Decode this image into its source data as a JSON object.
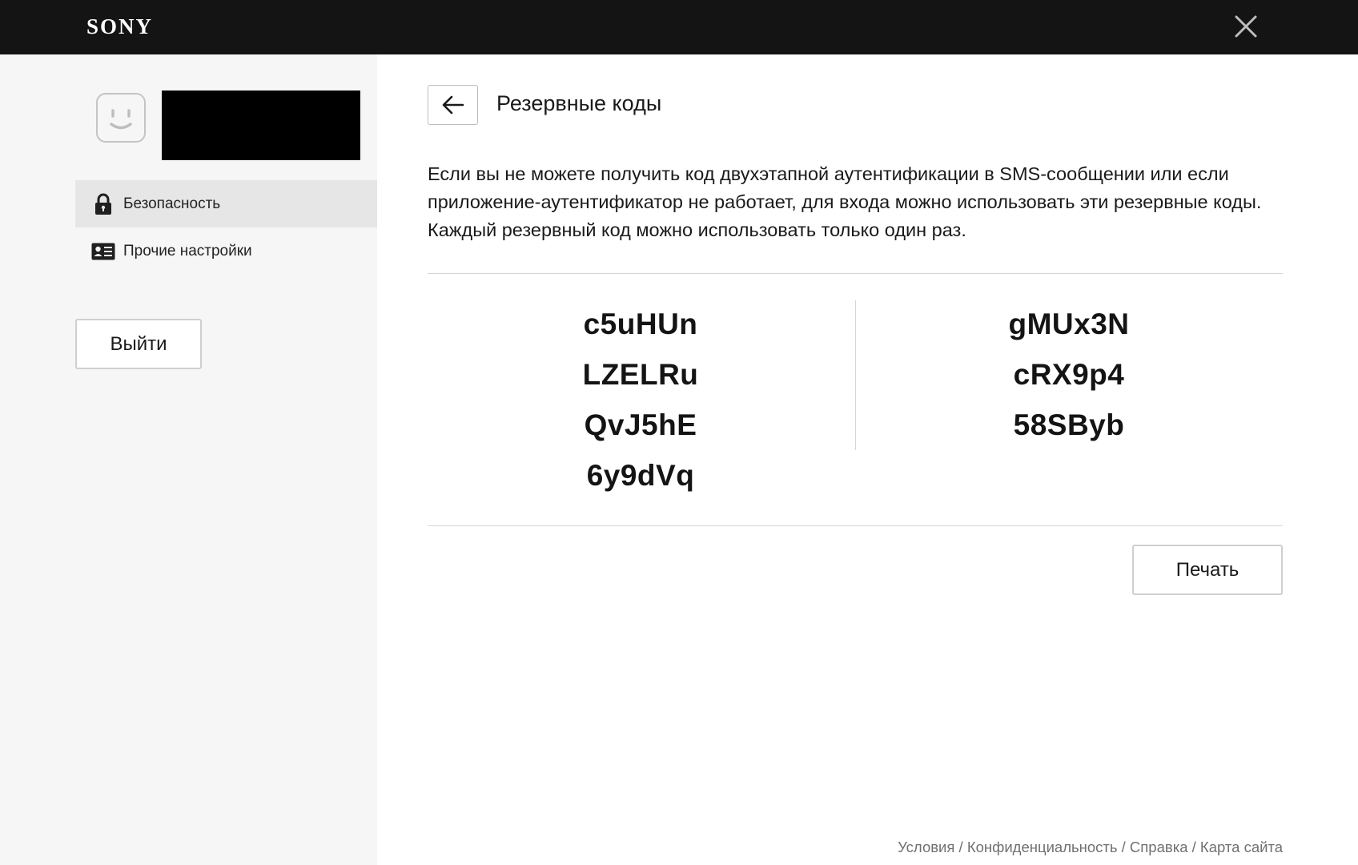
{
  "header": {
    "logo_text": "SONY",
    "close_icon": "close-icon"
  },
  "sidebar": {
    "avatar_icon": "smiley-face-icon",
    "nav_items": [
      {
        "label": "Безопасность",
        "icon": "lock-icon",
        "active": true
      },
      {
        "label": "Прочие настройки",
        "icon": "id-card-icon",
        "active": false
      }
    ],
    "logout_label": "Выйти"
  },
  "main": {
    "back_icon": "arrow-left-icon",
    "title": "Резервные коды",
    "description": "Если вы не можете получить код двухэтапной аутентификации в SMS-сообщении или если приложение-аутентификатор не работает, для входа можно использовать эти резервные коды. Каждый резервный код можно использовать только один раз.",
    "codes_left": [
      "c5uHUn",
      "LZELRu",
      "QvJ5hE",
      "6y9dVq"
    ],
    "codes_right": [
      "gMUx3N",
      "cRX9p4",
      "58SByb"
    ],
    "print_label": "Печать"
  },
  "footer": {
    "links": [
      "Условия",
      "Конфиденциальность",
      "Справка",
      "Карта сайта"
    ],
    "separator": " / "
  },
  "colors": {
    "topbar_bg": "#141414",
    "sidebar_bg": "#f6f6f6",
    "active_nav_bg": "#e6e6e6",
    "divider": "#d6d6d6"
  }
}
